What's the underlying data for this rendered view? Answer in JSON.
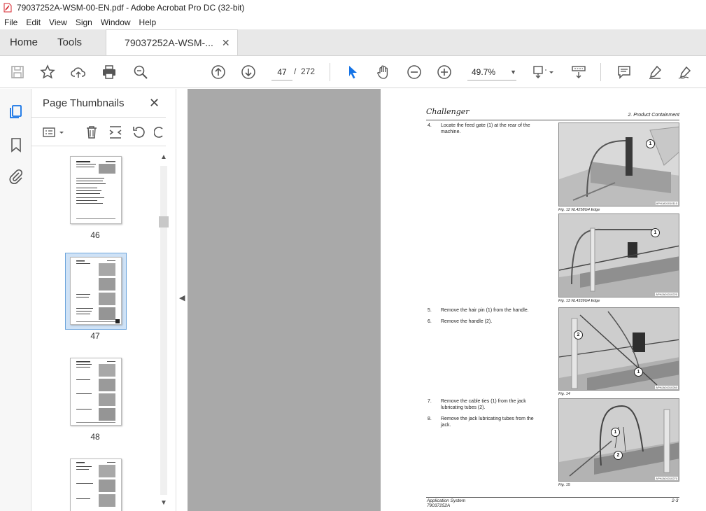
{
  "window": {
    "title": "79037252A-WSM-00-EN.pdf - Adobe Acrobat Pro DC (32-bit)"
  },
  "menu": [
    "File",
    "Edit",
    "View",
    "Sign",
    "Window",
    "Help"
  ],
  "tabs": {
    "home": "Home",
    "tools": "Tools",
    "document": "79037252A-WSM-..."
  },
  "toolbar": {
    "current_page": "47",
    "page_separator": "/",
    "total_pages": "272",
    "zoom": "49.7%"
  },
  "colors": {
    "accent": "#1473e6",
    "pdf_red": "#d4262c",
    "selection": "#cfe2f6"
  },
  "panel": {
    "title": "Page Thumbnails",
    "thumbnails": [
      {
        "label": "46",
        "selected": false
      },
      {
        "label": "47",
        "selected": true
      },
      {
        "label": "48",
        "selected": false
      },
      {
        "label": "",
        "selected": false
      }
    ]
  },
  "page": {
    "brand": "Challenger",
    "section": "2. Product Containment",
    "steps": [
      {
        "num": "4.",
        "text_line1": "Locate the feed gate (1) at the rear of the",
        "text_line2": "machine."
      },
      {
        "num": "5.",
        "text_line1": "Remove the hair pin (1) from the handle.",
        "text_line2": ""
      },
      {
        "num": "6.",
        "text_line1": "Remove the handle (2).",
        "text_line2": ""
      },
      {
        "num": "7.",
        "text_line1": "Remove the cable ties (1) from the jack",
        "text_line2": "lubricating tubes (2)."
      },
      {
        "num": "8.",
        "text_line1": "Remove the jack lubricating tubes from the",
        "text_line2": "jack."
      }
    ],
    "figures": [
      {
        "caption": "Fig. 12  NL4258G4 Edge",
        "code": "APHJA01010110"
      },
      {
        "caption": "Fig. 13  NL4339G4 Edge",
        "code": "APHJA01010220"
      },
      {
        "caption": "Fig. 14",
        "code": "APHJA01010260"
      },
      {
        "caption": "Fig. 15",
        "code": "APHJA01010270"
      }
    ],
    "footer": {
      "left_line1": "Application System",
      "left_line2": "79037252A",
      "right": "2-3"
    }
  }
}
